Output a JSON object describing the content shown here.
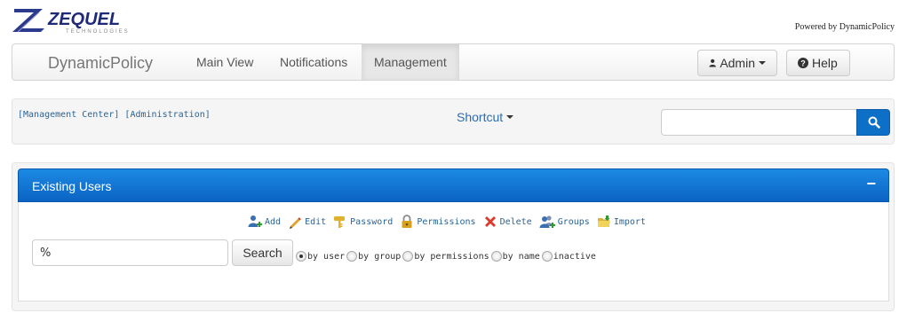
{
  "header": {
    "logo_text": "ZEQUEL",
    "logo_subtext": "TECHNOLOGIES",
    "powered_by": "Powered by DynamicPolicy"
  },
  "navbar": {
    "brand": "DynamicPolicy",
    "items": [
      {
        "label": "Main View",
        "active": false
      },
      {
        "label": "Notifications",
        "active": false
      },
      {
        "label": "Management",
        "active": true
      }
    ],
    "admin_label": "Admin",
    "help_label": "Help"
  },
  "breadcrumb": {
    "items": [
      "[Management Center]",
      "[Administration]"
    ]
  },
  "shortcut": {
    "label": "Shortcut"
  },
  "top_search": {
    "value": "",
    "placeholder": ""
  },
  "users_panel": {
    "title": "Existing Users",
    "collapse_symbol": "−",
    "actions": [
      {
        "label": "Add",
        "icon": "user-add-icon"
      },
      {
        "label": "Edit",
        "icon": "pencil-icon"
      },
      {
        "label": "Password",
        "icon": "key-icon"
      },
      {
        "label": "Permissions",
        "icon": "lock-icon"
      },
      {
        "label": "Delete",
        "icon": "delete-x-icon"
      },
      {
        "label": "Groups",
        "icon": "group-icon"
      },
      {
        "label": "Import",
        "icon": "folder-import-icon"
      }
    ],
    "search_value": "%",
    "search_button": "Search",
    "filter_options": [
      {
        "label": "by user",
        "checked": true
      },
      {
        "label": "by group",
        "checked": false
      },
      {
        "label": "by permissions",
        "checked": false
      },
      {
        "label": "by name",
        "checked": false
      },
      {
        "label": "inactive",
        "checked": false
      }
    ]
  },
  "colors": {
    "panel_header": "#0b63c3",
    "link": "#2a6496",
    "search_button": "#0e6fc7"
  }
}
